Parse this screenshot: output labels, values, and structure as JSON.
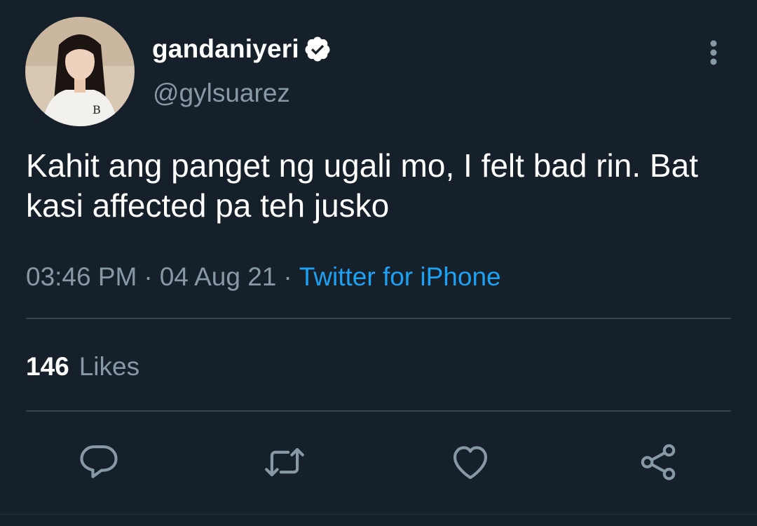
{
  "user": {
    "display_name": "gandaniyeri",
    "handle": "@gylsuarez",
    "verified": true,
    "avatar_icon": "profile-photo"
  },
  "tweet": {
    "text": "Kahit ang panget ng ugali mo, I felt bad rin. Bat kasi affected pa teh jusko",
    "time": "03:46 PM",
    "date": "04 Aug 21",
    "separator": "·",
    "source": "Twitter for iPhone"
  },
  "stats": {
    "likes_count": "146",
    "likes_label": "Likes"
  },
  "actions": {
    "reply_icon": "speech-bubble-icon",
    "retweet_icon": "retweet-icon",
    "like_icon": "heart-icon",
    "share_icon": "share-icon",
    "more_icon": "vertical-dots-icon"
  },
  "colors": {
    "background": "#15202b",
    "primary_text": "#ffffff",
    "secondary_text": "#8899a6",
    "link": "#1da1f2",
    "divider": "#38444d"
  }
}
